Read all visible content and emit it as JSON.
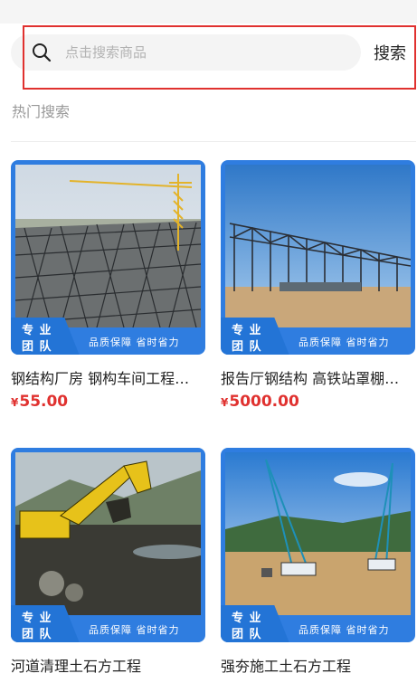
{
  "search": {
    "placeholder": "点击搜索商品",
    "button_label": "搜索"
  },
  "hot_search": {
    "title": "热门搜索"
  },
  "products": [
    {
      "title": "钢结构厂房 钢构车间工程…",
      "currency": "¥",
      "price": "55.00",
      "badge_line1": "专 业",
      "badge_line2": "团 队",
      "slogan": "品质保障 省时省力",
      "image": "steel-space-frame-roof-photo"
    },
    {
      "title": "报告厅钢结构 高铁站罩棚…",
      "currency": "¥",
      "price": "5000.00",
      "badge_line1": "专 业",
      "badge_line2": "团 队",
      "slogan": "品质保障 省时省力",
      "image": "steel-hall-frame-photo"
    },
    {
      "title": "河道清理土石方工程",
      "badge_line1": "专 业",
      "badge_line2": "团 队",
      "slogan": "品质保障 省时省力",
      "image": "excavator-river-cleaning-photo"
    },
    {
      "title": "强夯施工土石方工程",
      "badge_line1": "专 业",
      "badge_line2": "团 队",
      "slogan": "品质保障 省时省力",
      "image": "dynamic-compaction-cranes-photo"
    }
  ],
  "colors": {
    "accent_blue": "#2f7de0",
    "price_red": "#e0312f",
    "highlight_red": "#e0312f"
  }
}
